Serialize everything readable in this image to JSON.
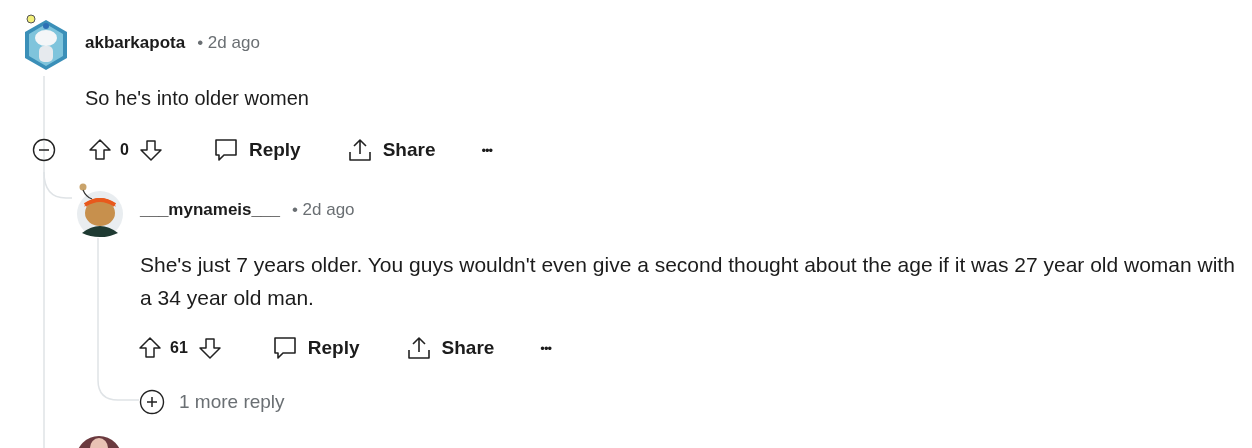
{
  "comment": {
    "username": "akbarkapota",
    "time": "• 2d ago",
    "body": "So he's into older women",
    "score": "0",
    "reply_label": "Reply",
    "share_label": "Share",
    "more_label": "•••",
    "reply": {
      "username": "___mynameis___",
      "time": "• 2d ago",
      "body": "She's just 7 years older. You guys wouldn't even give a second thought about the age if it was 27 year old woman with a 34 year old man.",
      "score": "61",
      "reply_label": "Reply",
      "share_label": "Share",
      "more_label": "•••",
      "more_replies": "1 more reply"
    }
  }
}
